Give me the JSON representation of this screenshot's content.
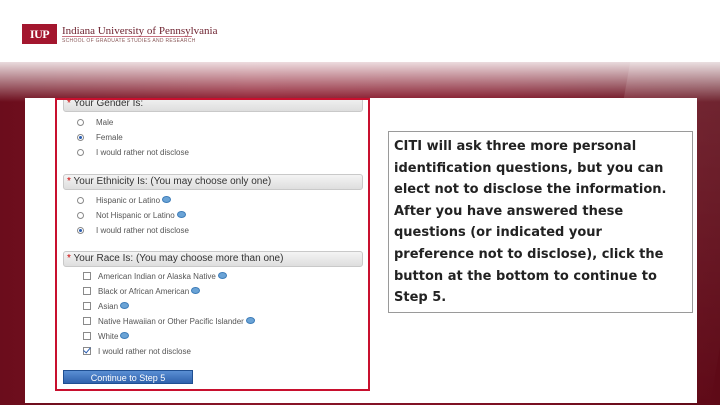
{
  "header": {
    "logo_mark": "IUP",
    "university_name": "Indiana University of Pennsylvania",
    "school_name": "SCHOOL OF GRADUATE STUDIES AND RESEARCH",
    "accent_color": "#a3162e"
  },
  "form": {
    "gender": {
      "star": "*",
      "title": "Your Gender Is:",
      "options": [
        {
          "label": "Male",
          "selected": false
        },
        {
          "label": "Female",
          "selected": true
        },
        {
          "label": "I would rather not disclose",
          "selected": false
        }
      ]
    },
    "ethnicity": {
      "star": "*",
      "title": "Your Ethnicity Is: (You may choose only one)",
      "options": [
        {
          "label": "Hispanic or Latino",
          "selected": false,
          "help": true
        },
        {
          "label": "Not Hispanic or Latino",
          "selected": false,
          "help": true
        },
        {
          "label": "I would rather not disclose",
          "selected": true,
          "help": false
        }
      ]
    },
    "race": {
      "star": "*",
      "title": "Your Race Is: (You may choose more than one)",
      "options": [
        {
          "label": "American Indian or Alaska Native",
          "checked": false,
          "help": true
        },
        {
          "label": "Black or African American",
          "checked": false,
          "help": true
        },
        {
          "label": "Asian",
          "checked": false,
          "help": true
        },
        {
          "label": "Native Hawaiian or Other Pacific Islander",
          "checked": false,
          "help": true
        },
        {
          "label": "White",
          "checked": false,
          "help": true
        },
        {
          "label": "I would rather not disclose",
          "checked": true,
          "help": false
        }
      ]
    },
    "submit_label": "Continue to Step 5"
  },
  "callout": {
    "text": "CITI will ask three more personal identification questions, but you can elect not to disclose the information. After you have answered these questions (or indicated your preference not to disclose), click the button at the bottom to continue to Step 5."
  }
}
